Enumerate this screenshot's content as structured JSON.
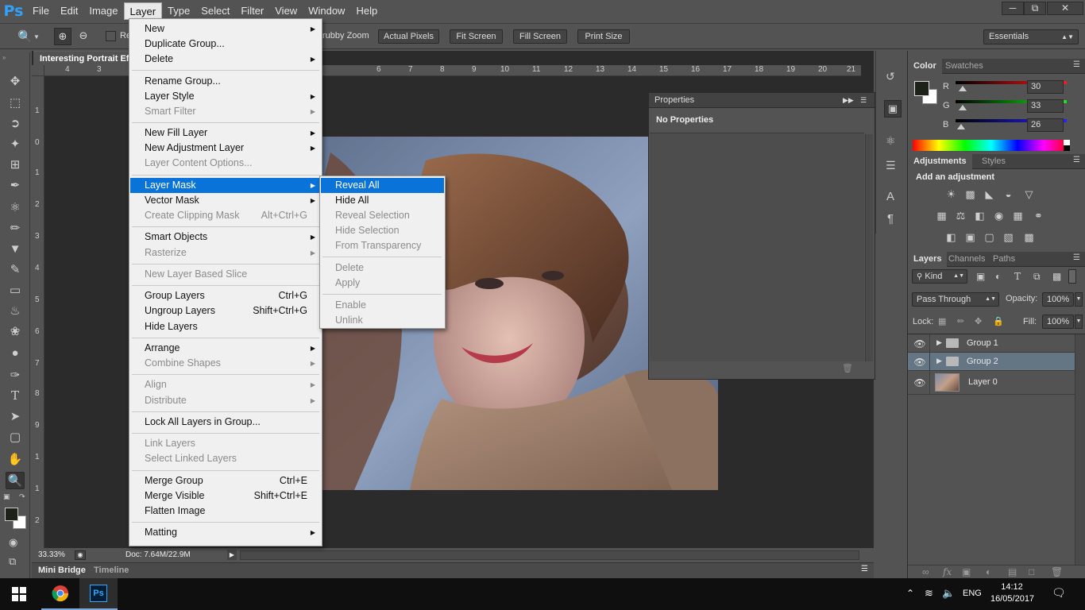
{
  "app": {
    "logo": "Ps"
  },
  "menubar": {
    "items": [
      "File",
      "Edit",
      "Image",
      "Layer",
      "Type",
      "Select",
      "Filter",
      "View",
      "Window",
      "Help"
    ],
    "active": "Layer",
    "window_controls": [
      "minimize-icon",
      "restore-icon",
      "close-icon"
    ]
  },
  "options": {
    "scrubby_zoom": "rubby Zoom",
    "resize_label_partial": "Re",
    "buttons": [
      "Actual Pixels",
      "Fit Screen",
      "Fill Screen",
      "Print Size"
    ],
    "workspace": "Essentials"
  },
  "document": {
    "tab_title": "Interesting Portrait Ef",
    "zoom": "33.33%",
    "doc_info": "Doc: 7.64M/22.9M",
    "ruler_top": [
      "4",
      "3",
      "6",
      "7",
      "8",
      "9",
      "10",
      "11",
      "12",
      "13",
      "14",
      "15",
      "16",
      "17",
      "18",
      "19",
      "20",
      "21"
    ],
    "ruler_left": [
      "1",
      "0",
      "1",
      "2",
      "3",
      "4",
      "5",
      "6",
      "7",
      "8",
      "9",
      "1",
      "1",
      "2"
    ]
  },
  "bottom_tabs": [
    "Mini Bridge",
    "Timeline"
  ],
  "properties": {
    "title": "Properties",
    "body": "No Properties"
  },
  "color_panel": {
    "tabs": [
      "Color",
      "Swatches"
    ],
    "channels": [
      {
        "label": "R",
        "value": "30"
      },
      {
        "label": "G",
        "value": "33"
      },
      {
        "label": "B",
        "value": "26"
      }
    ],
    "foreground": "#1e211a",
    "background": "#ffffff"
  },
  "adjustments_panel": {
    "tabs": [
      "Adjustments",
      "Styles"
    ],
    "heading": "Add an adjustment",
    "icons": [
      "brightness-icon",
      "levels-icon",
      "curves-icon",
      "exposure-icon",
      "vibrance-icon",
      "hue-saturation-icon",
      "color-balance-icon",
      "black-white-icon",
      "photo-filter-icon",
      "channel-mixer-icon",
      "color-lookup-icon",
      "invert-icon",
      "posterize-icon",
      "threshold-icon",
      "selective-color-icon",
      "gradient-map-icon"
    ]
  },
  "layers_panel": {
    "tabs": [
      "Layers",
      "Channels",
      "Paths"
    ],
    "filter_kind": "Kind",
    "blend_mode": "Pass Through",
    "opacity_label": "Opacity:",
    "opacity": "100%",
    "lock_label": "Lock:",
    "fill_label": "Fill:",
    "fill": "100%",
    "layers": [
      {
        "name": "Group 1",
        "type": "group",
        "selected": false
      },
      {
        "name": "Group 2",
        "type": "group",
        "selected": true
      },
      {
        "name": "Layer 0",
        "type": "pixel",
        "selected": false
      }
    ],
    "footer_icons": [
      "link-icon",
      "fx-icon",
      "mask-icon",
      "adjustment-layer-icon",
      "new-group-icon",
      "new-layer-icon",
      "trash-icon"
    ]
  },
  "layer_menu": {
    "items": [
      {
        "label": "New",
        "submenu": true
      },
      {
        "label": "Duplicate Group..."
      },
      {
        "label": "Delete",
        "submenu": true
      },
      {
        "sep": true
      },
      {
        "label": "Rename Group..."
      },
      {
        "label": "Layer Style",
        "submenu": true
      },
      {
        "label": "Smart Filter",
        "submenu": true,
        "disabled": true
      },
      {
        "sep": true
      },
      {
        "label": "New Fill Layer",
        "submenu": true
      },
      {
        "label": "New Adjustment Layer",
        "submenu": true
      },
      {
        "label": "Layer Content Options...",
        "disabled": true
      },
      {
        "sep": true
      },
      {
        "label": "Layer Mask",
        "submenu": true,
        "highlighted": true
      },
      {
        "label": "Vector Mask",
        "submenu": true
      },
      {
        "label": "Create Clipping Mask",
        "shortcut": "Alt+Ctrl+G",
        "disabled": true
      },
      {
        "sep": true
      },
      {
        "label": "Smart Objects",
        "submenu": true
      },
      {
        "label": "Rasterize",
        "submenu": true,
        "disabled": true
      },
      {
        "sep": true
      },
      {
        "label": "New Layer Based Slice",
        "disabled": true
      },
      {
        "sep": true
      },
      {
        "label": "Group Layers",
        "shortcut": "Ctrl+G"
      },
      {
        "label": "Ungroup Layers",
        "shortcut": "Shift+Ctrl+G"
      },
      {
        "label": "Hide Layers"
      },
      {
        "sep": true
      },
      {
        "label": "Arrange",
        "submenu": true
      },
      {
        "label": "Combine Shapes",
        "submenu": true,
        "disabled": true
      },
      {
        "sep": true
      },
      {
        "label": "Align",
        "submenu": true,
        "disabled": true
      },
      {
        "label": "Distribute",
        "submenu": true,
        "disabled": true
      },
      {
        "sep": true
      },
      {
        "label": "Lock All Layers in Group..."
      },
      {
        "sep": true
      },
      {
        "label": "Link Layers",
        "disabled": true
      },
      {
        "label": "Select Linked Layers",
        "disabled": true
      },
      {
        "sep": true
      },
      {
        "label": "Merge Group",
        "shortcut": "Ctrl+E"
      },
      {
        "label": "Merge Visible",
        "shortcut": "Shift+Ctrl+E"
      },
      {
        "label": "Flatten Image"
      },
      {
        "sep": true
      },
      {
        "label": "Matting",
        "submenu": true
      }
    ]
  },
  "layer_mask_submenu": {
    "items": [
      {
        "label": "Reveal All",
        "highlighted": true
      },
      {
        "label": "Hide All"
      },
      {
        "label": "Reveal Selection",
        "disabled": true
      },
      {
        "label": "Hide Selection",
        "disabled": true
      },
      {
        "label": "From Transparency",
        "disabled": true
      },
      {
        "sep": true
      },
      {
        "label": "Delete",
        "disabled": true
      },
      {
        "label": "Apply",
        "disabled": true
      },
      {
        "sep": true
      },
      {
        "label": "Enable",
        "disabled": true
      },
      {
        "label": "Unlink",
        "disabled": true
      }
    ]
  },
  "taskbar": {
    "apps": [
      "chrome-icon",
      "photoshop-icon"
    ],
    "photoshop_label": "Ps",
    "language": "ENG",
    "time": "14:12",
    "date": "16/05/2017"
  }
}
